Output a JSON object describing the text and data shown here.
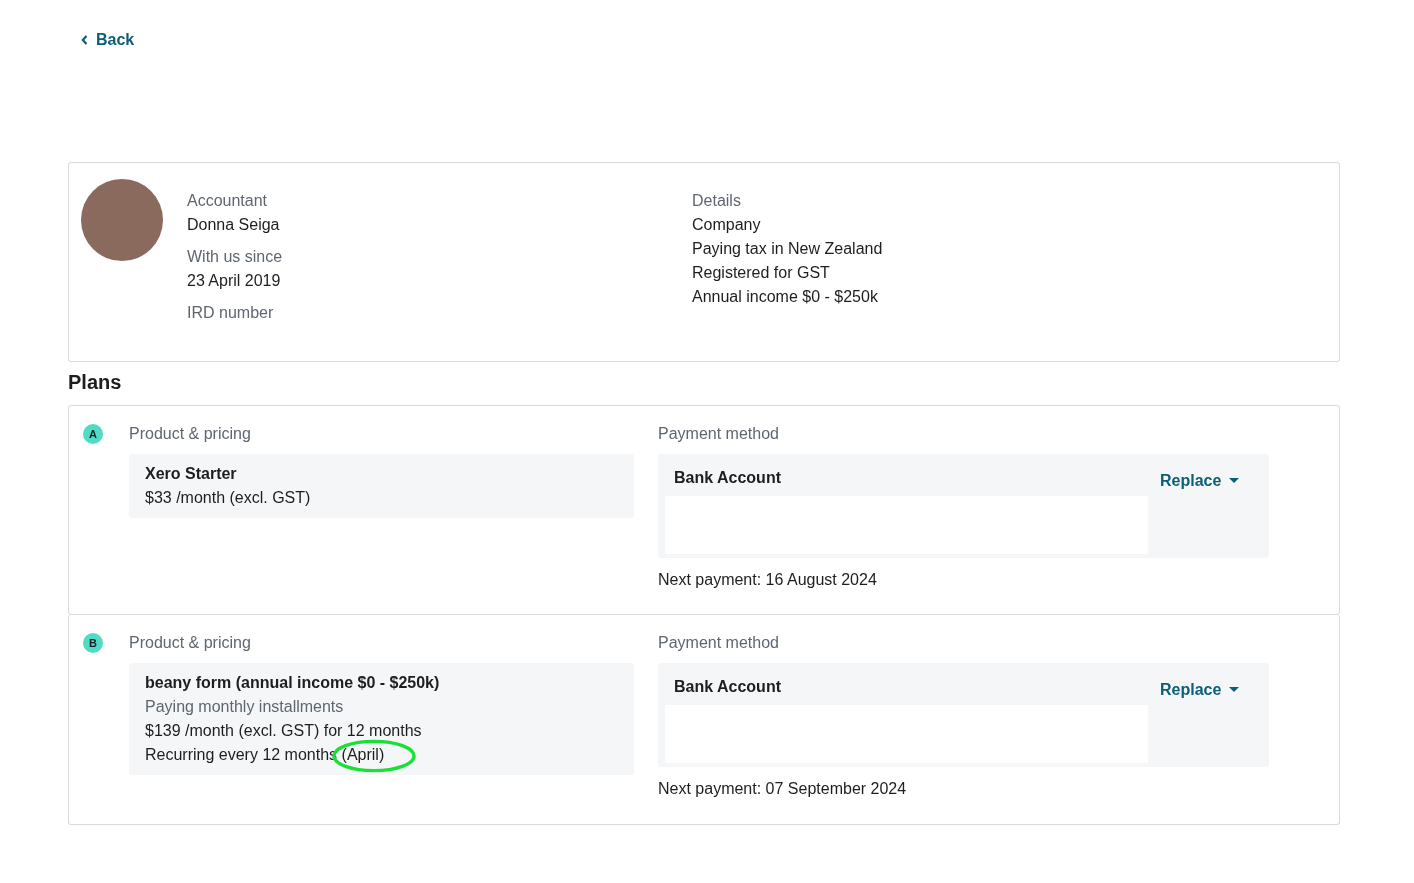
{
  "back_link": {
    "label": "Back"
  },
  "profile": {
    "fields": [
      {
        "label": "Accountant",
        "value": "Donna Seiga"
      },
      {
        "label": "With us since",
        "value": "23 April 2019"
      },
      {
        "label": "IRD number"
      }
    ],
    "details": {
      "label": "Details",
      "lines": [
        "Company",
        "Paying tax in New Zealand",
        "Registered for GST",
        "Annual income $0 - $250k"
      ]
    }
  },
  "plans_heading": "Plans",
  "plans": [
    {
      "badge": "A",
      "product_label": "Product & pricing",
      "product_name": "Xero Starter",
      "product_lines": [
        {
          "kind": "text",
          "text": "$33 /month (excl. GST)"
        }
      ],
      "payment_label": "Payment method",
      "payment_title": "Bank Account",
      "replace_label": "Replace",
      "next_payment": "Next payment: 16 August 2024"
    },
    {
      "badge": "B",
      "product_label": "Product & pricing",
      "product_name": "beany form (annual income $0 - $250k)",
      "product_lines": [
        {
          "kind": "muted",
          "text": "Paying monthly installments"
        },
        {
          "kind": "text",
          "text": "$139 /month (excl. GST) for 12 months"
        },
        {
          "kind": "text",
          "text": "Recurring every 12 months",
          "circled_text": "(April)"
        }
      ],
      "payment_label": "Payment method",
      "payment_title": "Bank Account",
      "replace_label": "Replace",
      "next_payment": "Next payment: 07 September 2024"
    }
  ]
}
